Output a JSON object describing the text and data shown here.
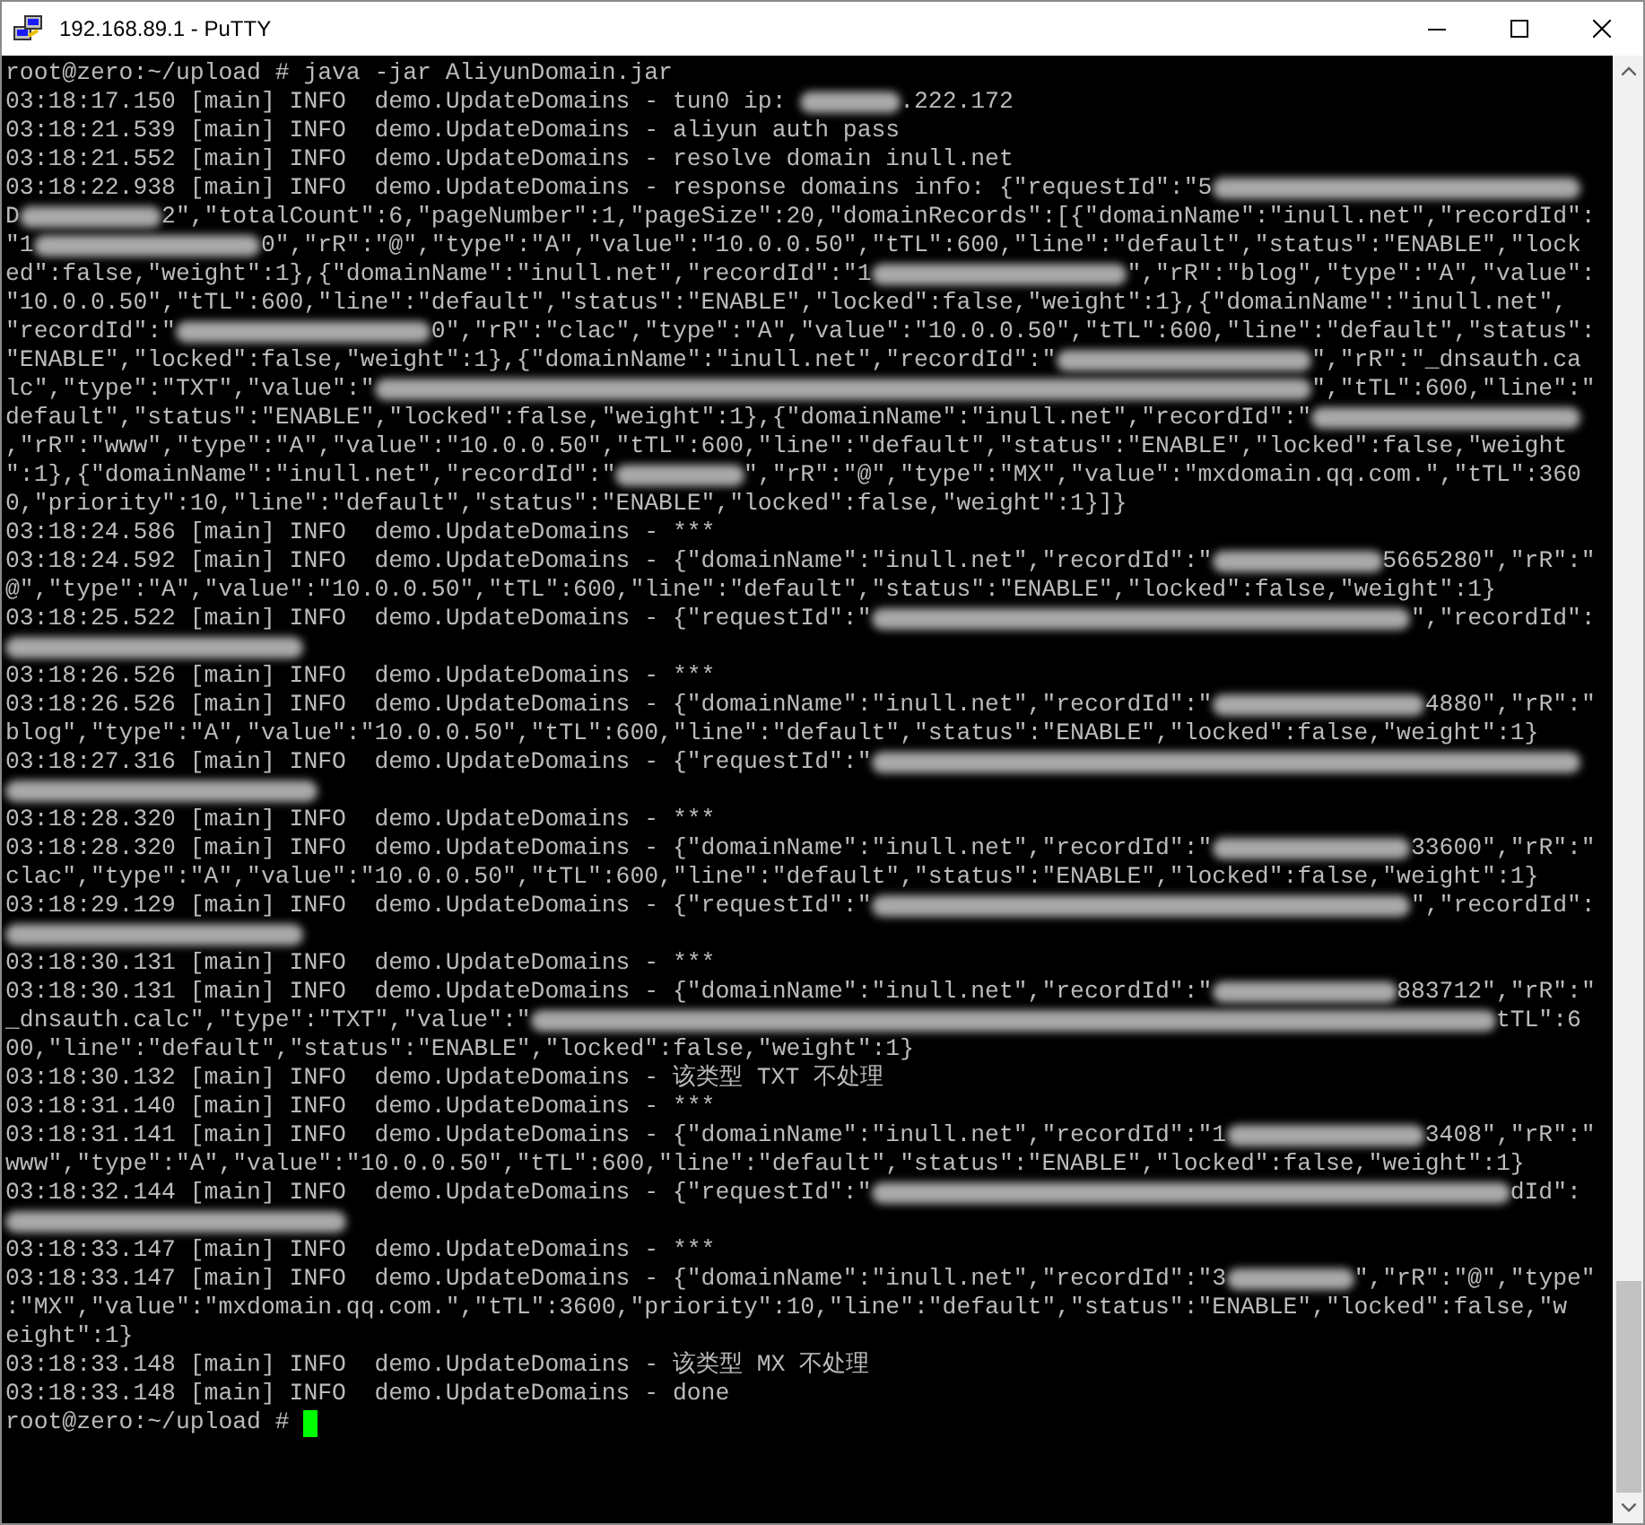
{
  "window": {
    "title": "192.168.89.1 - PuTTY"
  },
  "terminal": {
    "lines": [
      [
        {
          "kind": "text",
          "text": "root@zero:~/upload # java -jar AliyunDomain.jar"
        }
      ],
      [
        {
          "kind": "text",
          "text": "03:18:17.150 [main] INFO  demo.UpdateDomains - tun0 ip: "
        },
        {
          "kind": "redacted"
        },
        {
          "kind": "text",
          "text": ".222.172"
        }
      ],
      [
        {
          "kind": "text",
          "text": "03:18:21.539 [main] INFO  demo.UpdateDomains - aliyun auth pass"
        }
      ],
      [
        {
          "kind": "text",
          "text": "03:18:21.552 [main] INFO  demo.UpdateDomains - resolve domain inull.net"
        }
      ],
      [
        {
          "kind": "text",
          "text": "03:18:22.938 [main] INFO  demo.UpdateDomains - response domains info: {\"requestId\":\"5"
        },
        {
          "kind": "redacted"
        }
      ],
      [
        {
          "kind": "text",
          "text": "D"
        },
        {
          "kind": "redacted"
        },
        {
          "kind": "text",
          "text": "2\",\"totalCount\":6,\"pageNumber\":1,\"pageSize\":20,\"domainRecords\":[{\"domainName\":\"inull.net\",\"recordId\":"
        }
      ],
      [
        {
          "kind": "text",
          "text": "\"1"
        },
        {
          "kind": "redacted"
        },
        {
          "kind": "text",
          "text": "0\",\"rR\":\"@\",\"type\":\"A\",\"value\":\"10.0.0.50\",\"tTL\":600,\"line\":\"default\",\"status\":\"ENABLE\",\"lock"
        }
      ],
      [
        {
          "kind": "text",
          "text": "ed\":false,\"weight\":1},{\"domainName\":\"inull.net\",\"recordId\":\"1"
        },
        {
          "kind": "redacted"
        },
        {
          "kind": "text",
          "text": "\",\"rR\":\"blog\",\"type\":\"A\",\"value\":"
        }
      ],
      [
        {
          "kind": "text",
          "text": "\"10.0.0.50\",\"tTL\":600,\"line\":\"default\",\"status\":\"ENABLE\",\"locked\":false,\"weight\":1},{\"domainName\":\"inull.net\","
        }
      ],
      [
        {
          "kind": "text",
          "text": "\"recordId\":\""
        },
        {
          "kind": "redacted"
        },
        {
          "kind": "text",
          "text": "0\",\"rR\":\"clac\",\"type\":\"A\",\"value\":\"10.0.0.50\",\"tTL\":600,\"line\":\"default\",\"status\":"
        }
      ],
      [
        {
          "kind": "text",
          "text": "\"ENABLE\",\"locked\":false,\"weight\":1},{\"domainName\":\"inull.net\",\"recordId\":\""
        },
        {
          "kind": "redacted"
        },
        {
          "kind": "text",
          "text": "\",\"rR\":\"_dnsauth.ca"
        }
      ],
      [
        {
          "kind": "text",
          "text": "lc\",\"type\":\"TXT\",\"value\":\""
        },
        {
          "kind": "redacted"
        },
        {
          "kind": "text",
          "text": "\",\"tTL\":600,\"line\":\""
        }
      ],
      [
        {
          "kind": "text",
          "text": "default\",\"status\":\"ENABLE\",\"locked\":false,\"weight\":1},{\"domainName\":\"inull.net\",\"recordId\":\""
        },
        {
          "kind": "redacted"
        }
      ],
      [
        {
          "kind": "text",
          "text": ",\"rR\":\"www\",\"type\":\"A\",\"value\":\"10.0.0.50\",\"tTL\":600,\"line\":\"default\",\"status\":\"ENABLE\",\"locked\":false,\"weight"
        }
      ],
      [
        {
          "kind": "text",
          "text": "\":1},{\"domainName\":\"inull.net\",\"recordId\":\""
        },
        {
          "kind": "redacted"
        },
        {
          "kind": "text",
          "text": "\",\"rR\":\"@\",\"type\":\"MX\",\"value\":\"mxdomain.qq.com.\",\"tTL\":360"
        }
      ],
      [
        {
          "kind": "text",
          "text": "0,\"priority\":10,\"line\":\"default\",\"status\":\"ENABLE\",\"locked\":false,\"weight\":1}]}"
        }
      ],
      [
        {
          "kind": "text",
          "text": "03:18:24.586 [main] INFO  demo.UpdateDomains - ***"
        }
      ],
      [
        {
          "kind": "text",
          "text": "03:18:24.592 [main] INFO  demo.UpdateDomains - {\"domainName\":\"inull.net\",\"recordId\":\""
        },
        {
          "kind": "redacted"
        },
        {
          "kind": "text",
          "text": "5665280\",\"rR\":\""
        }
      ],
      [
        {
          "kind": "text",
          "text": "@\",\"type\":\"A\",\"value\":\"10.0.0.50\",\"tTL\":600,\"line\":\"default\",\"status\":\"ENABLE\",\"locked\":false,\"weight\":1}"
        }
      ],
      [
        {
          "kind": "text",
          "text": "03:18:25.522 [main] INFO  demo.UpdateDomains - {\"requestId\":\""
        },
        {
          "kind": "redacted"
        },
        {
          "kind": "text",
          "text": "\",\"recordId\":"
        }
      ],
      [
        {
          "kind": "redacted"
        }
      ],
      [
        {
          "kind": "text",
          "text": "03:18:26.526 [main] INFO  demo.UpdateDomains - ***"
        }
      ],
      [
        {
          "kind": "text",
          "text": "03:18:26.526 [main] INFO  demo.UpdateDomains - {\"domainName\":\"inull.net\",\"recordId\":\""
        },
        {
          "kind": "redacted"
        },
        {
          "kind": "text",
          "text": "4880\",\"rR\":\""
        }
      ],
      [
        {
          "kind": "text",
          "text": "blog\",\"type\":\"A\",\"value\":\"10.0.0.50\",\"tTL\":600,\"line\":\"default\",\"status\":\"ENABLE\",\"locked\":false,\"weight\":1}"
        }
      ],
      [
        {
          "kind": "text",
          "text": "03:18:27.316 [main] INFO  demo.UpdateDomains - {\"requestId\":\""
        },
        {
          "kind": "redacted"
        }
      ],
      [
        {
          "kind": "redacted"
        }
      ],
      [
        {
          "kind": "text",
          "text": "03:18:28.320 [main] INFO  demo.UpdateDomains - ***"
        }
      ],
      [
        {
          "kind": "text",
          "text": "03:18:28.320 [main] INFO  demo.UpdateDomains - {\"domainName\":\"inull.net\",\"recordId\":\""
        },
        {
          "kind": "redacted"
        },
        {
          "kind": "text",
          "text": "33600\",\"rR\":\""
        }
      ],
      [
        {
          "kind": "text",
          "text": "clac\",\"type\":\"A\",\"value\":\"10.0.0.50\",\"tTL\":600,\"line\":\"default\",\"status\":\"ENABLE\",\"locked\":false,\"weight\":1}"
        }
      ],
      [
        {
          "kind": "text",
          "text": "03:18:29.129 [main] INFO  demo.UpdateDomains - {\"requestId\":\""
        },
        {
          "kind": "redacted"
        },
        {
          "kind": "text",
          "text": "\",\"recordId\":"
        }
      ],
      [
        {
          "kind": "redacted"
        }
      ],
      [
        {
          "kind": "text",
          "text": "03:18:30.131 [main] INFO  demo.UpdateDomains - ***"
        }
      ],
      [
        {
          "kind": "text",
          "text": "03:18:30.131 [main] INFO  demo.UpdateDomains - {\"domainName\":\"inull.net\",\"recordId\":\""
        },
        {
          "kind": "redacted"
        },
        {
          "kind": "text",
          "text": "883712\",\"rR\":\""
        }
      ],
      [
        {
          "kind": "text",
          "text": "_dnsauth.calc\",\"type\":\"TXT\",\"value\":\""
        },
        {
          "kind": "redacted"
        },
        {
          "kind": "text",
          "text": "tTL\":6"
        }
      ],
      [
        {
          "kind": "text",
          "text": "00,\"line\":\"default\",\"status\":\"ENABLE\",\"locked\":false,\"weight\":1}"
        }
      ],
      [
        {
          "kind": "text",
          "text": "03:18:30.132 [main] INFO  demo.UpdateDomains - 该类型 TXT 不处理"
        }
      ],
      [
        {
          "kind": "text",
          "text": "03:18:31.140 [main] INFO  demo.UpdateDomains - ***"
        }
      ],
      [
        {
          "kind": "text",
          "text": "03:18:31.141 [main] INFO  demo.UpdateDomains - {\"domainName\":\"inull.net\",\"recordId\":\"1"
        },
        {
          "kind": "redacted"
        },
        {
          "kind": "text",
          "text": "3408\",\"rR\":\""
        }
      ],
      [
        {
          "kind": "text",
          "text": "www\",\"type\":\"A\",\"value\":\"10.0.0.50\",\"tTL\":600,\"line\":\"default\",\"status\":\"ENABLE\",\"locked\":false,\"weight\":1}"
        }
      ],
      [
        {
          "kind": "text",
          "text": "03:18:32.144 [main] INFO  demo.UpdateDomains - {\"requestId\":\""
        },
        {
          "kind": "redacted"
        },
        {
          "kind": "text",
          "text": "dId\":"
        }
      ],
      [
        {
          "kind": "redacted"
        }
      ],
      [
        {
          "kind": "text",
          "text": "03:18:33.147 [main] INFO  demo.UpdateDomains - ***"
        }
      ],
      [
        {
          "kind": "text",
          "text": "03:18:33.147 [main] INFO  demo.UpdateDomains - {\"domainName\":\"inull.net\",\"recordId\":\"3"
        },
        {
          "kind": "redacted"
        },
        {
          "kind": "text",
          "text": "\",\"rR\":\"@\",\"type\""
        }
      ],
      [
        {
          "kind": "text",
          "text": ":\"MX\",\"value\":\"mxdomain.qq.com.\",\"tTL\":3600,\"priority\":10,\"line\":\"default\",\"status\":\"ENABLE\",\"locked\":false,\"w"
        }
      ],
      [
        {
          "kind": "text",
          "text": "eight\":1}"
        }
      ],
      [
        {
          "kind": "text",
          "text": "03:18:33.148 [main] INFO  demo.UpdateDomains - 该类型 MX 不处理"
        }
      ],
      [
        {
          "kind": "text",
          "text": "03:18:33.148 [main] INFO  demo.UpdateDomains - done"
        }
      ],
      [
        {
          "kind": "text",
          "text": "root@zero:~/upload # "
        },
        {
          "kind": "cursor"
        }
      ]
    ]
  }
}
